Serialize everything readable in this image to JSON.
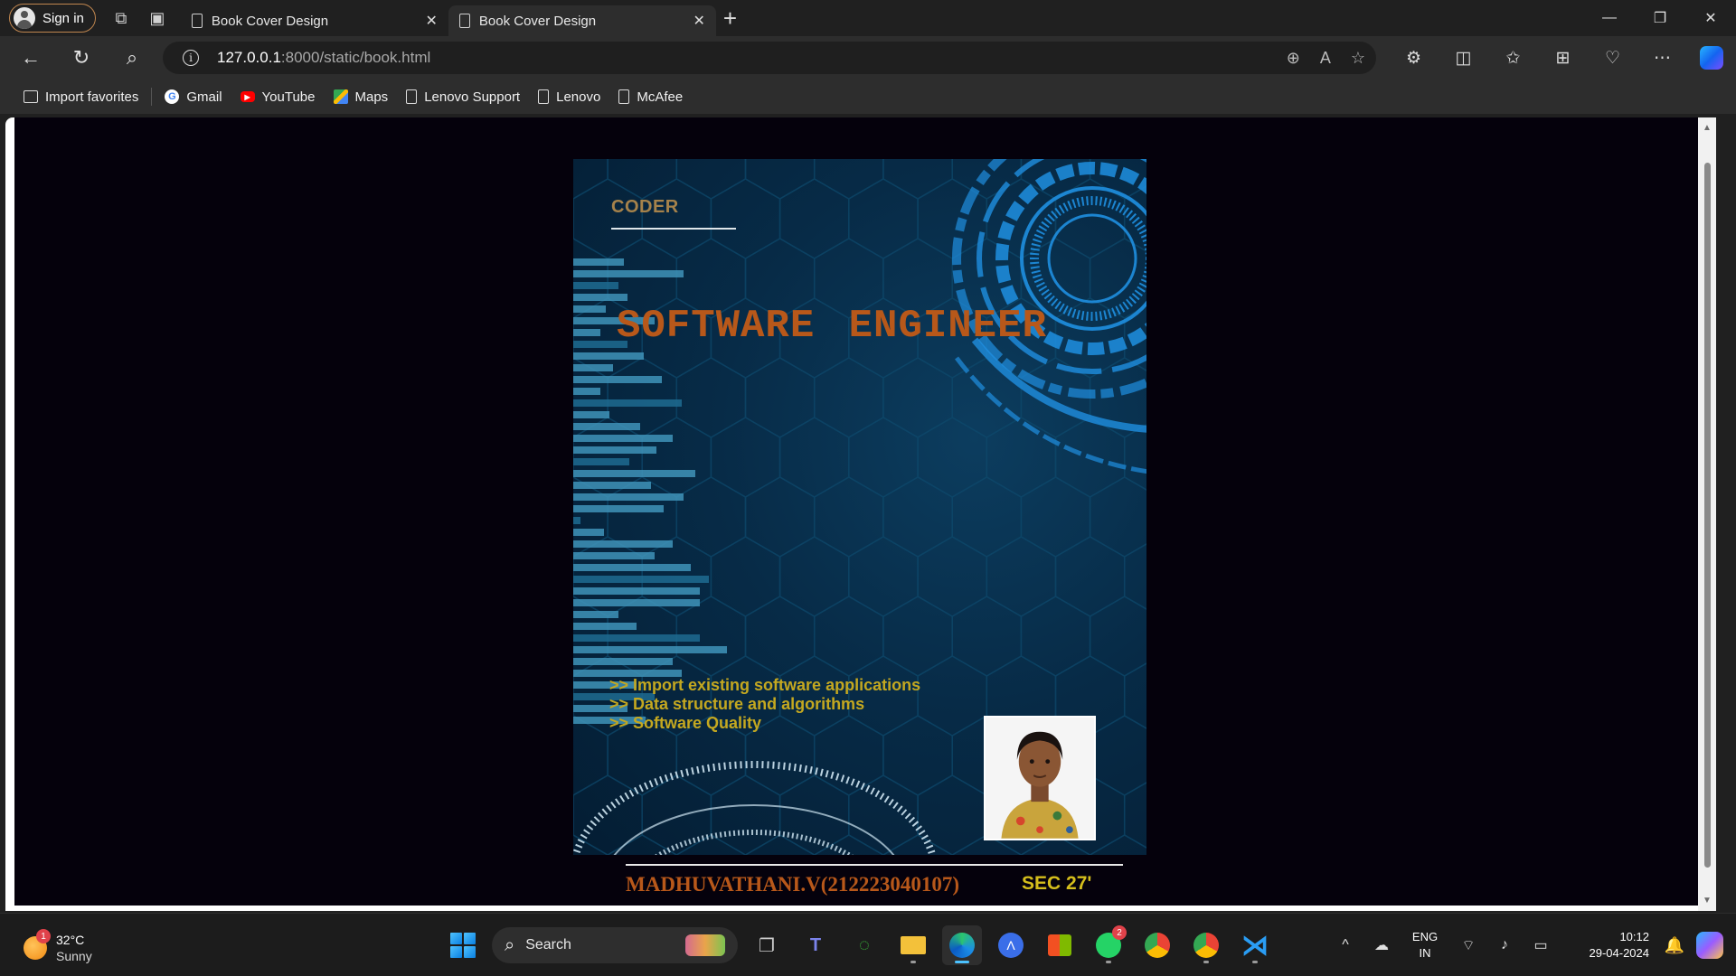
{
  "browser": {
    "sign_in": "Sign in",
    "tabs": [
      {
        "title": "Book Cover Design"
      },
      {
        "title": "Book Cover Design"
      }
    ],
    "url_host": "127.0.0.1",
    "url_rest": ":8000/static/book.html",
    "bookmarks": [
      {
        "label": "Import favorites",
        "icon": "import-icon"
      },
      {
        "label": "Gmail",
        "icon": "google-icon"
      },
      {
        "label": "YouTube",
        "icon": "youtube-icon"
      },
      {
        "label": "Maps",
        "icon": "maps-icon"
      },
      {
        "label": "Lenovo Support",
        "icon": "page-icon"
      },
      {
        "label": "Lenovo",
        "icon": "page-icon"
      },
      {
        "label": "McAfee",
        "icon": "page-icon"
      }
    ]
  },
  "cover": {
    "tag": "CODER",
    "title": "SOFTWARE ENGINEER",
    "bullets": [
      ">> Import existing software applications",
      ">> Data structure and algorithms",
      ">> Software Quality"
    ],
    "author": "MADHUVATHANI.V(212223040107)",
    "section": "SEC 27'"
  },
  "taskbar": {
    "weather_temp": "32°C",
    "weather_cond": "Sunny",
    "weather_badge": "1",
    "search_label": "Search",
    "whatsapp_badge": "2",
    "lang_line1": "ENG",
    "lang_line2": "IN",
    "time": "10:12",
    "date": "29-04-2024"
  },
  "colors": {
    "cover_title": "#b8581a",
    "bullet_text": "#c4a820",
    "cover_bg": "#072b47"
  }
}
